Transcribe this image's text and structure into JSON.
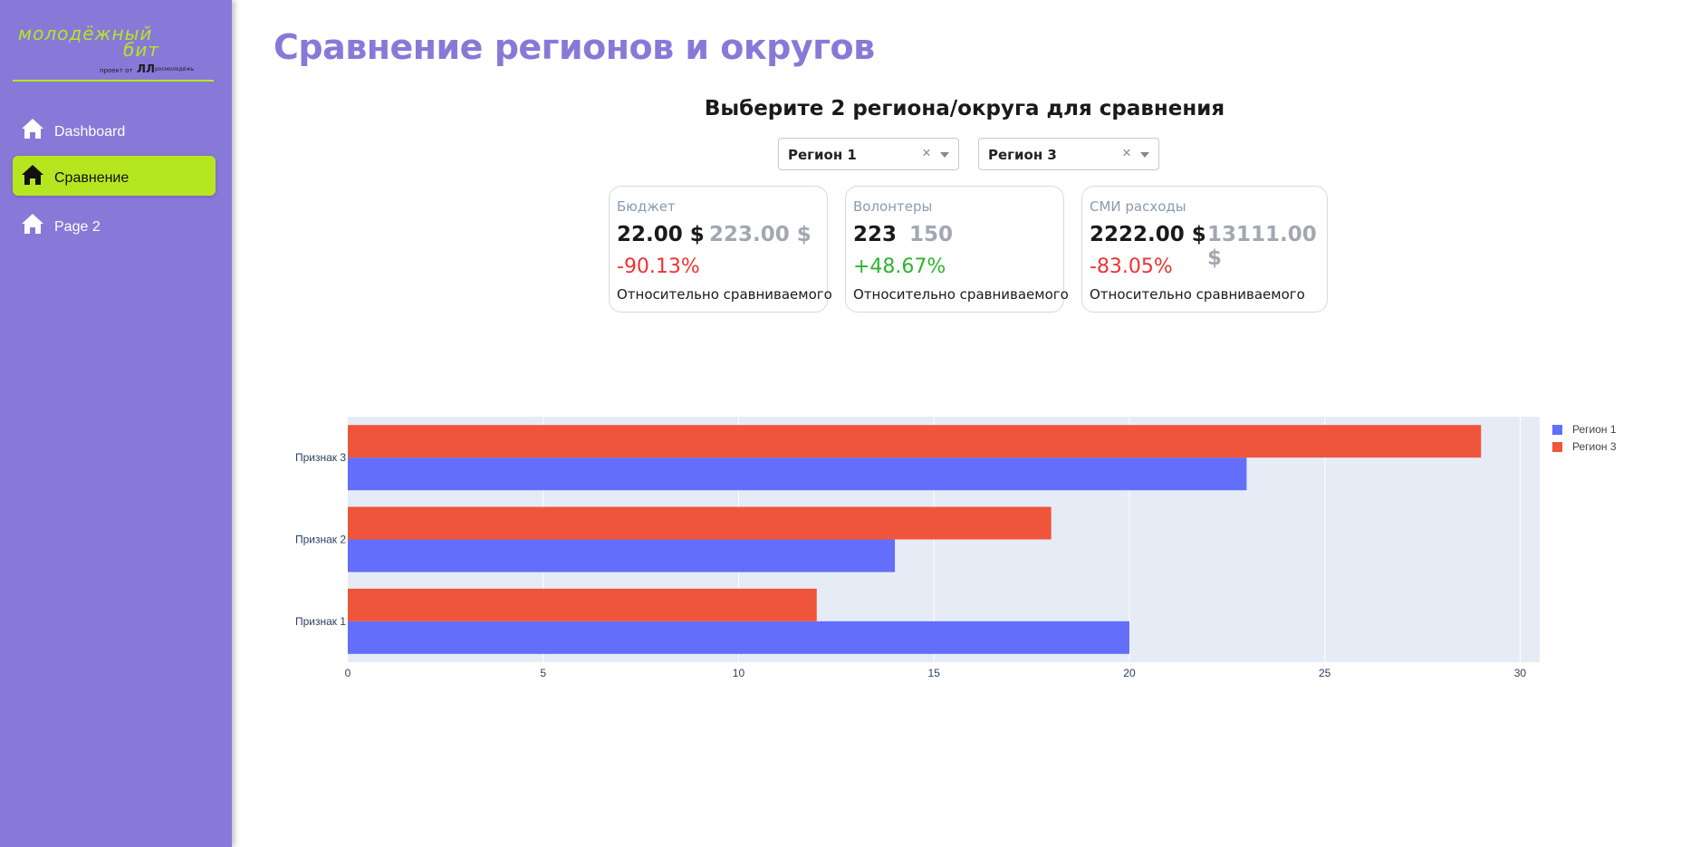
{
  "sidebar": {
    "logo_text": "молодёжный бит",
    "logo_sub": "проект от росмолодёжь",
    "items": [
      {
        "label": "Dashboard",
        "icon": "home-icon",
        "active": false
      },
      {
        "label": "Сравнение",
        "icon": "home-icon",
        "active": true
      },
      {
        "label": "Page 2",
        "icon": "home-icon",
        "active": false
      }
    ]
  },
  "main": {
    "title": "Сравнение регионов и округов",
    "subtitle": "Выберите 2 региона/округа для сравнения",
    "select1": {
      "value": "Регион 1"
    },
    "select2": {
      "value": "Регион 3"
    },
    "cards": [
      {
        "title": "Бюджет",
        "value1": "22.00 $",
        "value2": "223.00 $",
        "change": "-90.13%",
        "note": "Относительно сравниваемого",
        "positive": false
      },
      {
        "title": "Волонтеры",
        "value1": "223",
        "value2": "150",
        "change": "+48.67%",
        "note": "Относительно сравниваемого",
        "positive": true
      },
      {
        "title": "СМИ расходы",
        "value1": "2222.00 $",
        "value2": "13111.00 $",
        "change": "-83.05%",
        "note": "Относительно сравниваемого",
        "positive": false
      }
    ]
  },
  "colors": {
    "accent": "#8879d8",
    "lime": "#b6e620",
    "negative": "#ee3333",
    "positive": "#2db52d"
  },
  "chart_data": {
    "type": "bar",
    "orientation": "horizontal",
    "categories": [
      "Признак 1",
      "Признак 2",
      "Признак 3"
    ],
    "series": [
      {
        "name": "Регион 1",
        "values": [
          20,
          14,
          23
        ],
        "color": "#636efa"
      },
      {
        "name": "Регион 3",
        "values": [
          12,
          18,
          29
        ],
        "color": "#ef553b"
      }
    ],
    "xlim": [
      0,
      30.5
    ],
    "xticks": [
      0,
      5,
      10,
      15,
      20,
      25,
      30
    ],
    "grid": true,
    "legend_position": "top-right",
    "background": "#e5ecf6"
  }
}
